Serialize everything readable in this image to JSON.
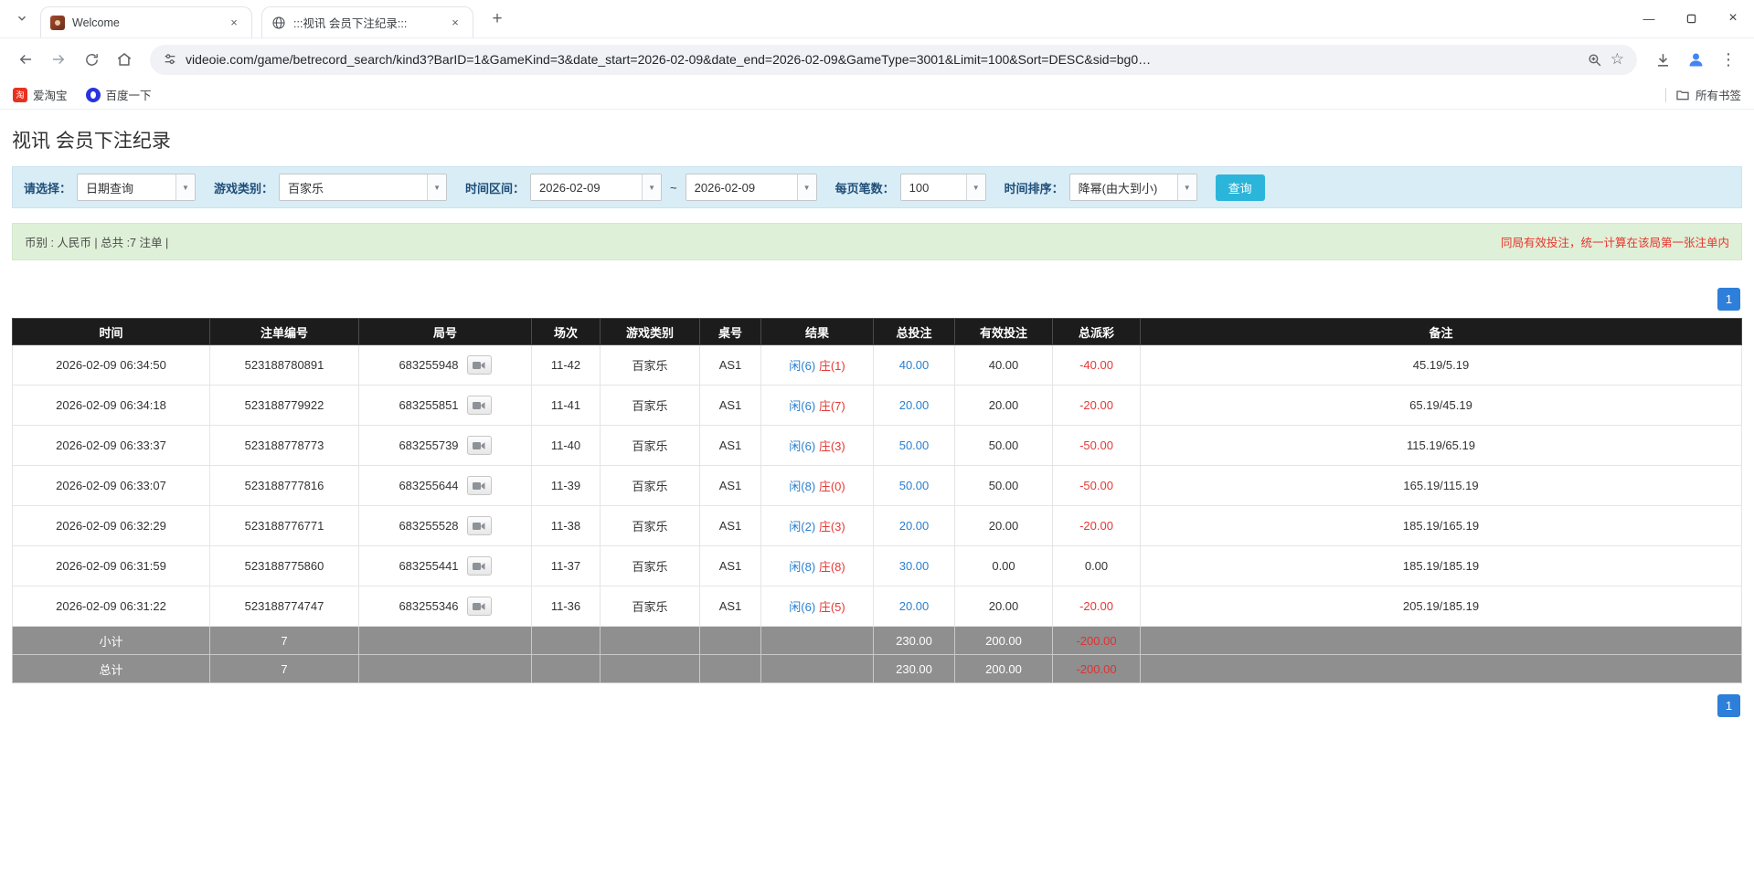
{
  "browser": {
    "tabs": [
      {
        "title": "Welcome"
      },
      {
        "title": ":::视讯 会员下注纪录:::"
      }
    ],
    "url": "videoie.com/game/betrecord_search/kind3?BarID=1&GameKind=3&date_start=2026-02-09&date_end=2026-02-09&GameType=3001&Limit=100&Sort=DESC&sid=bg0…",
    "bookmarks": [
      {
        "label": "爱淘宝"
      },
      {
        "label": "百度一下"
      }
    ],
    "all_bookmarks": "所有书签"
  },
  "page": {
    "title": "视讯 会员下注纪录",
    "filters": {
      "select_label": "请选择：",
      "select_value": "日期查询",
      "game_kind_label": "游戏类别：",
      "game_kind_value": "百家乐",
      "date_range_label": "时间区间：",
      "date_start": "2026-02-09",
      "date_separator": "~",
      "date_end": "2026-02-09",
      "per_page_label": "每页笔数：",
      "per_page_value": "100",
      "sort_label": "时间排序：",
      "sort_value": "降幂(由大到小)",
      "search_button": "查询"
    },
    "info_bar": {
      "left": "币别 : 人民币 | 总共 :7 注单 |",
      "right": "同局有效投注，统一计算在该局第一张注单内"
    },
    "pagination": {
      "page": "1"
    },
    "table": {
      "headers": [
        "时间",
        "注单编号",
        "局号",
        "场次",
        "游戏类别",
        "桌号",
        "结果",
        "总投注",
        "有效投注",
        "总派彩",
        "备注"
      ],
      "rows": [
        {
          "time": "2026-02-09 06:34:50",
          "bet_id": "523188780891",
          "round_no": "683255948",
          "session": "11-42",
          "game_kind": "百家乐",
          "table_no": "AS1",
          "result_player": "闲(6)",
          "result_banker": "庄(1)",
          "total_bet": "40.00",
          "valid_bet": "40.00",
          "payout": "-40.00",
          "remark": "45.19/5.19"
        },
        {
          "time": "2026-02-09 06:34:18",
          "bet_id": "523188779922",
          "round_no": "683255851",
          "session": "11-41",
          "game_kind": "百家乐",
          "table_no": "AS1",
          "result_player": "闲(6)",
          "result_banker": "庄(7)",
          "total_bet": "20.00",
          "valid_bet": "20.00",
          "payout": "-20.00",
          "remark": "65.19/45.19"
        },
        {
          "time": "2026-02-09 06:33:37",
          "bet_id": "523188778773",
          "round_no": "683255739",
          "session": "11-40",
          "game_kind": "百家乐",
          "table_no": "AS1",
          "result_player": "闲(6)",
          "result_banker": "庄(3)",
          "total_bet": "50.00",
          "valid_bet": "50.00",
          "payout": "-50.00",
          "remark": "115.19/65.19"
        },
        {
          "time": "2026-02-09 06:33:07",
          "bet_id": "523188777816",
          "round_no": "683255644",
          "session": "11-39",
          "game_kind": "百家乐",
          "table_no": "AS1",
          "result_player": "闲(8)",
          "result_banker": "庄(0)",
          "total_bet": "50.00",
          "valid_bet": "50.00",
          "payout": "-50.00",
          "remark": "165.19/115.19"
        },
        {
          "time": "2026-02-09 06:32:29",
          "bet_id": "523188776771",
          "round_no": "683255528",
          "session": "11-38",
          "game_kind": "百家乐",
          "table_no": "AS1",
          "result_player": "闲(2)",
          "result_banker": "庄(3)",
          "total_bet": "20.00",
          "valid_bet": "20.00",
          "payout": "-20.00",
          "remark": "185.19/165.19"
        },
        {
          "time": "2026-02-09 06:31:59",
          "bet_id": "523188775860",
          "round_no": "683255441",
          "session": "11-37",
          "game_kind": "百家乐",
          "table_no": "AS1",
          "result_player": "闲(8)",
          "result_banker": "庄(8)",
          "total_bet": "30.00",
          "valid_bet": "0.00",
          "payout": "0.00",
          "remark": "185.19/185.19"
        },
        {
          "time": "2026-02-09 06:31:22",
          "bet_id": "523188774747",
          "round_no": "683255346",
          "session": "11-36",
          "game_kind": "百家乐",
          "table_no": "AS1",
          "result_player": "闲(6)",
          "result_banker": "庄(5)",
          "total_bet": "20.00",
          "valid_bet": "20.00",
          "payout": "-20.00",
          "remark": "205.19/185.19"
        }
      ],
      "footer_rows": [
        {
          "label": "小计",
          "count": "7",
          "total_bet": "230.00",
          "valid_bet": "200.00",
          "payout": "-200.00"
        },
        {
          "label": "总计",
          "count": "7",
          "total_bet": "230.00",
          "valid_bet": "200.00",
          "payout": "-200.00"
        }
      ]
    }
  },
  "colors": {
    "search_button": "#2cb5da",
    "pagination_active": "#2e7fd9",
    "player_blue": "#2a7fd0",
    "banker_red": "#e53935",
    "negative_red": "#e53935",
    "table_header_bg": "#1c1c1c",
    "table_footer_bg": "#8f8f8f",
    "filter_bar_bg": "#d9edf6",
    "info_bar_bg": "#dff0d8"
  }
}
